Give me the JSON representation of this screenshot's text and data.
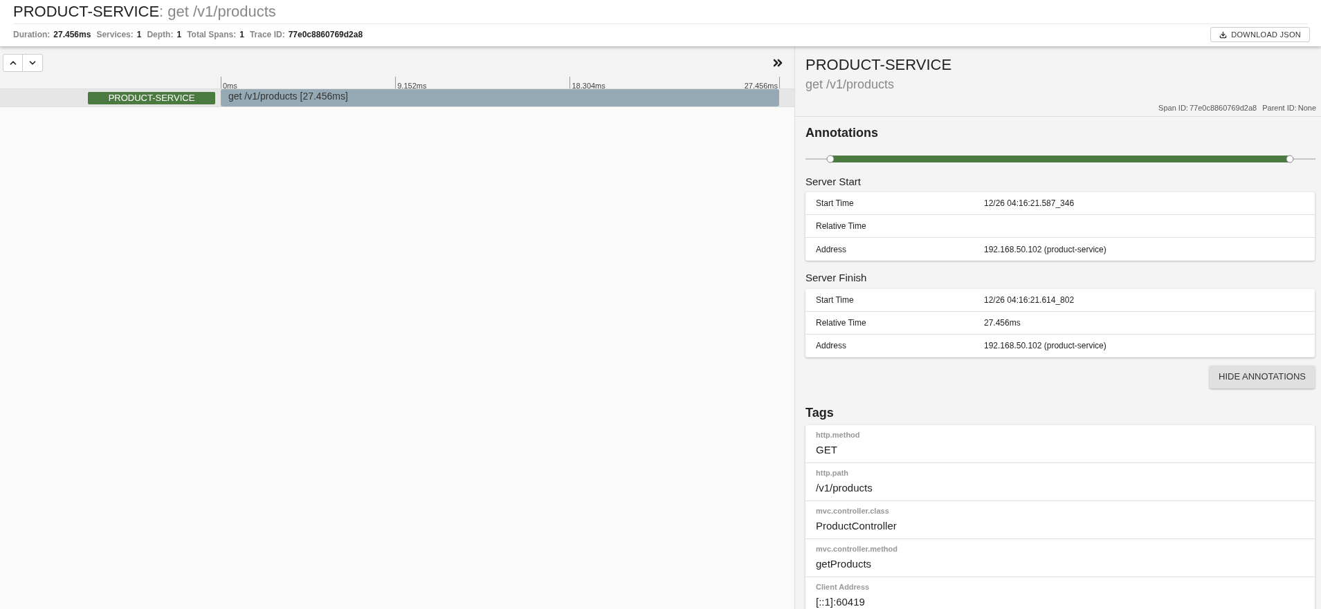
{
  "header": {
    "service": "PRODUCT-SERVICE",
    "span_name": ": get /v1/products",
    "stats": [
      {
        "label": "Duration:",
        "value": "27.456ms"
      },
      {
        "label": "Services:",
        "value": "1"
      },
      {
        "label": "Depth:",
        "value": "1"
      },
      {
        "label": "Total Spans:",
        "value": "1"
      },
      {
        "label": "Trace ID:",
        "value": "77e0c8860769d2a8"
      }
    ],
    "download_button": "DOWNLOAD JSON"
  },
  "timeline": {
    "ticks": [
      "0ms",
      "9.152ms",
      "18.304ms",
      "27.456ms"
    ],
    "spans": [
      {
        "service": "PRODUCT-SERVICE",
        "label": "get /v1/products [27.456ms]",
        "selected": true
      }
    ]
  },
  "detail": {
    "service": "PRODUCT-SERVICE",
    "span_name": "get /v1/products",
    "ids": [
      {
        "label": "Span ID:",
        "value": "77e0c8860769d2a8"
      },
      {
        "label": "Parent ID:",
        "value": "None"
      }
    ],
    "annotations_title": "Annotations",
    "annotations": [
      {
        "title": "Server Start",
        "rows": [
          {
            "label": "Start Time",
            "value": "12/26 04:16:21.587_346"
          },
          {
            "label": "Relative Time",
            "value": ""
          },
          {
            "label": "Address",
            "value": "192.168.50.102 (product-service)"
          }
        ]
      },
      {
        "title": "Server Finish",
        "rows": [
          {
            "label": "Start Time",
            "value": "12/26 04:16:21.614_802"
          },
          {
            "label": "Relative Time",
            "value": "27.456ms"
          },
          {
            "label": "Address",
            "value": "192.168.50.102 (product-service)"
          }
        ]
      }
    ],
    "hide_button": "HIDE ANNOTATIONS",
    "tags_title": "Tags",
    "tags": [
      {
        "key": "http.method",
        "value": "GET"
      },
      {
        "key": "http.path",
        "value": "/v1/products"
      },
      {
        "key": "mvc.controller.class",
        "value": "ProductController"
      },
      {
        "key": "mvc.controller.method",
        "value": "getProducts"
      },
      {
        "key": "Client Address",
        "value": "[::1]:60419"
      }
    ]
  }
}
